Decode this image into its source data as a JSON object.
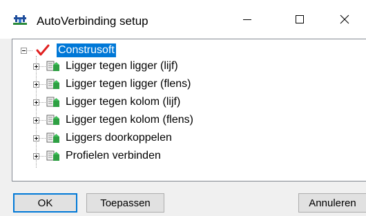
{
  "window": {
    "title": "AutoVerbinding setup",
    "icon": "bridge-app-icon",
    "controls": {
      "minimize_icon": "minimize-icon",
      "maximize_icon": "maximize-icon",
      "close_icon": "close-icon"
    }
  },
  "tree": {
    "root": {
      "label": "Construsoft",
      "icon": "red-checkmark-icon",
      "expanded": true,
      "selected": true
    },
    "children": [
      {
        "label": "Ligger tegen ligger (lijf)",
        "icon": "rule-document-icon",
        "expanded": false
      },
      {
        "label": "Ligger tegen ligger (flens)",
        "icon": "rule-document-icon",
        "expanded": false
      },
      {
        "label": "Ligger tegen kolom (lijf)",
        "icon": "rule-document-icon",
        "expanded": false
      },
      {
        "label": "Ligger tegen kolom (flens)",
        "icon": "rule-document-icon",
        "expanded": false
      },
      {
        "label": "Liggers doorkoppelen",
        "icon": "rule-document-icon",
        "expanded": false
      },
      {
        "label": "Profielen verbinden",
        "icon": "rule-document-icon",
        "expanded": false
      }
    ]
  },
  "buttons": {
    "ok": "OK",
    "apply": "Toepassen",
    "cancel": "Annuleren"
  },
  "colors": {
    "selection": "#0078d7",
    "check_red": "#e02020",
    "icon_green": "#2ea043"
  }
}
